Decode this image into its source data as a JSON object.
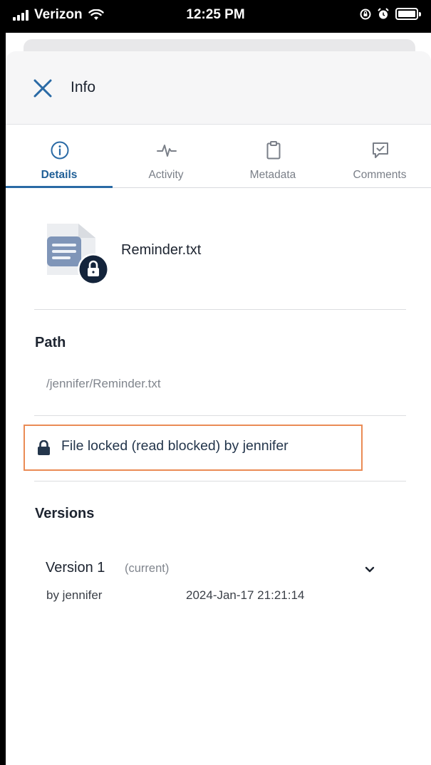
{
  "status_bar": {
    "carrier": "Verizon",
    "time": "12:25 PM"
  },
  "header": {
    "title": "Info"
  },
  "tabs": [
    {
      "label": "Details",
      "icon": "info-icon",
      "active": true
    },
    {
      "label": "Activity",
      "icon": "activity-icon",
      "active": false
    },
    {
      "label": "Metadata",
      "icon": "clipboard-icon",
      "active": false
    },
    {
      "label": "Comments",
      "icon": "comment-icon",
      "active": false
    }
  ],
  "file": {
    "name": "Reminder.txt",
    "icon": "text-file-locked-icon"
  },
  "path": {
    "label": "Path",
    "value": "/jennifer/Reminder.txt"
  },
  "lock": {
    "text": "File locked (read blocked) by jennifer"
  },
  "versions": {
    "label": "Versions",
    "items": [
      {
        "title": "Version 1",
        "status": "(current)",
        "author": "by jennifer",
        "date": "2024-Jan-17 21:21:14"
      }
    ]
  },
  "colors": {
    "accent": "#2a6aa5",
    "highlight_border": "#ea8b55",
    "status_bar": "#000000"
  }
}
